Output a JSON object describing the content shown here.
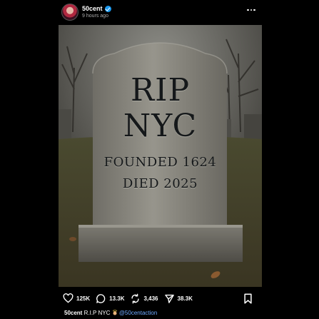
{
  "header": {
    "username": "50cent",
    "verified": true,
    "timestamp": "9 hours ago",
    "more_icon": "more-horizontal-icon"
  },
  "image": {
    "headstone_lines": [
      "RIP",
      "NYC",
      "FOUNDED 1624",
      "DIED 2025"
    ]
  },
  "actions": {
    "likes": "125K",
    "comments": "13.3K",
    "reposts": "3,436",
    "shares": "38.3K"
  },
  "caption": {
    "username": "50cent",
    "text": "R.I.P NYC",
    "mention": "@50centaction"
  },
  "colors": {
    "background": "#000000",
    "text": "#ffffff",
    "secondary_text": "#aaaaaa",
    "link": "#6ea8fe",
    "verified": "#1d9bf0"
  }
}
